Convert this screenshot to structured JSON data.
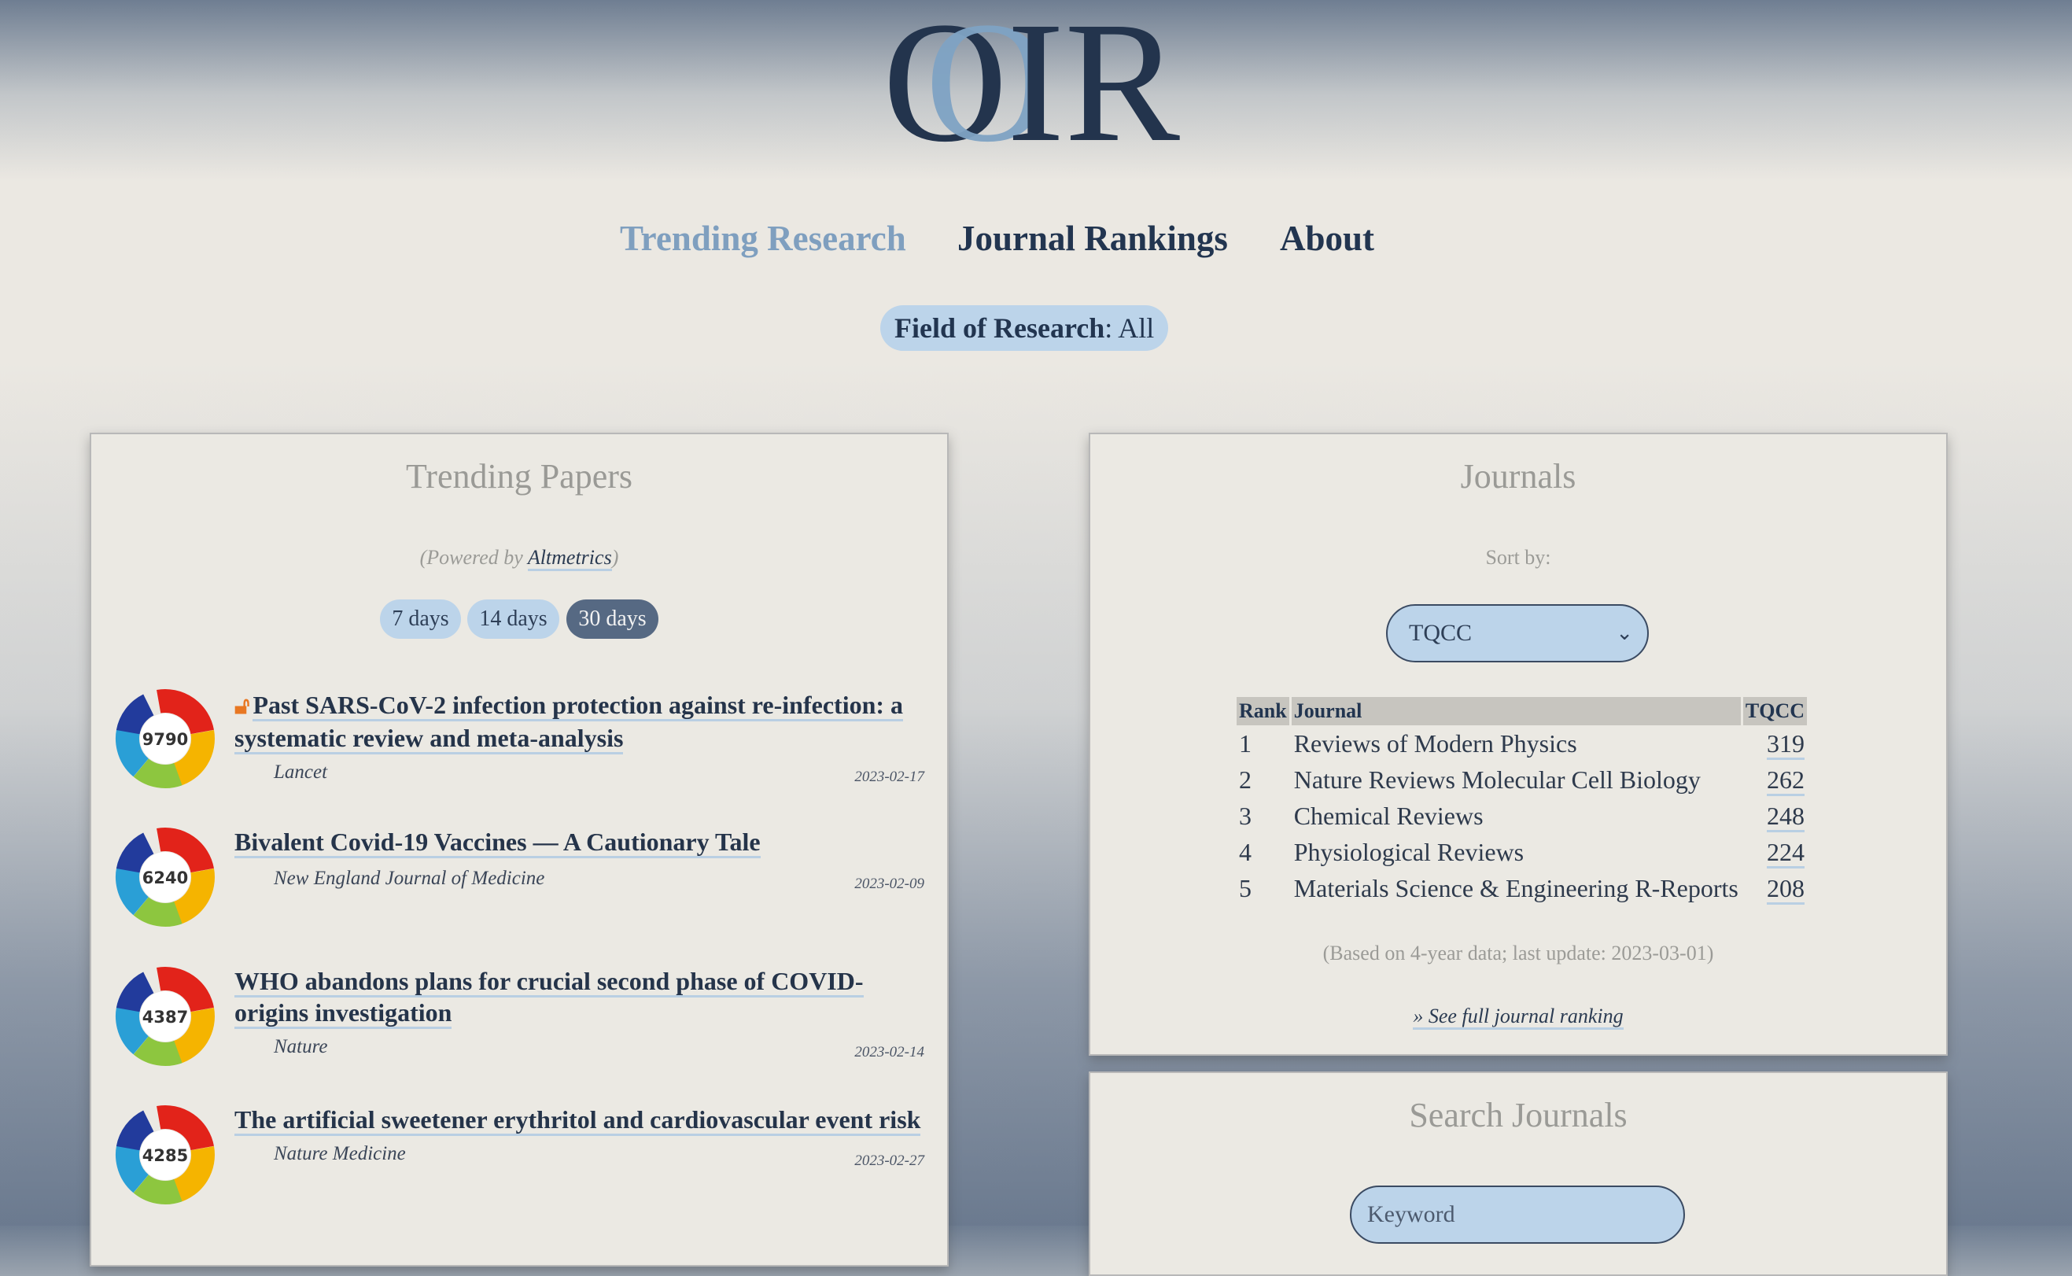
{
  "logo": {
    "text": "OIR"
  },
  "nav": {
    "items": [
      {
        "label": "Trending Research"
      },
      {
        "label": "Journal Rankings"
      },
      {
        "label": "About"
      }
    ]
  },
  "field": {
    "label": "Field of Research",
    "value": "All"
  },
  "trending": {
    "title": "Trending Papers",
    "powered_prefix": "(Powered by ",
    "powered_link": "Altmetrics",
    "powered_suffix": ")",
    "periods": [
      "7 days",
      "14 days",
      "30 days"
    ],
    "selected_period": "30 days",
    "papers": [
      {
        "score": "9790",
        "title": "Past SARS-CoV-2 infection protection against re-infection: a systematic review and meta-analysis",
        "journal": "Lancet",
        "date": "2023-02-17",
        "open_access": true
      },
      {
        "score": "6240",
        "title": "Bivalent Covid-19 Vaccines — A Cautionary Tale",
        "journal": "New England Journal of Medicine",
        "date": "2023-02-09",
        "open_access": false
      },
      {
        "score": "4387",
        "title": "WHO abandons plans for crucial second phase of COVID-origins investigation",
        "journal": "Nature",
        "date": "2023-02-14",
        "open_access": false
      },
      {
        "score": "4285",
        "title": "The artificial sweetener erythritol and cardiovascular event risk",
        "journal": "Nature Medicine",
        "date": "2023-02-27",
        "open_access": false
      }
    ]
  },
  "journals": {
    "title": "Journals",
    "sort_label": "Sort by:",
    "sort_value": "TQCC",
    "columns": [
      "Rank",
      "Journal",
      "TQCC"
    ],
    "rows": [
      {
        "rank": "1",
        "journal": "Reviews of Modern Physics",
        "tqcc": "319"
      },
      {
        "rank": "2",
        "journal": "Nature Reviews Molecular Cell Biology",
        "tqcc": "262"
      },
      {
        "rank": "3",
        "journal": "Chemical Reviews",
        "tqcc": "248"
      },
      {
        "rank": "4",
        "journal": "Physiological Reviews",
        "tqcc": "224"
      },
      {
        "rank": "5",
        "journal": "Materials Science & Engineering R-Reports",
        "tqcc": "208"
      }
    ],
    "basis_note": "(Based on 4-year data; last update: 2023-03-01)",
    "full_ranking_link": "» See full journal ranking"
  },
  "search": {
    "title": "Search Journals",
    "placeholder": "Keyword"
  },
  "colors": {
    "accent": "#7f9fbf",
    "navy": "#223550",
    "pill": "#bcd4ea",
    "active_pill": "#566983",
    "open_access": "#e87722"
  }
}
